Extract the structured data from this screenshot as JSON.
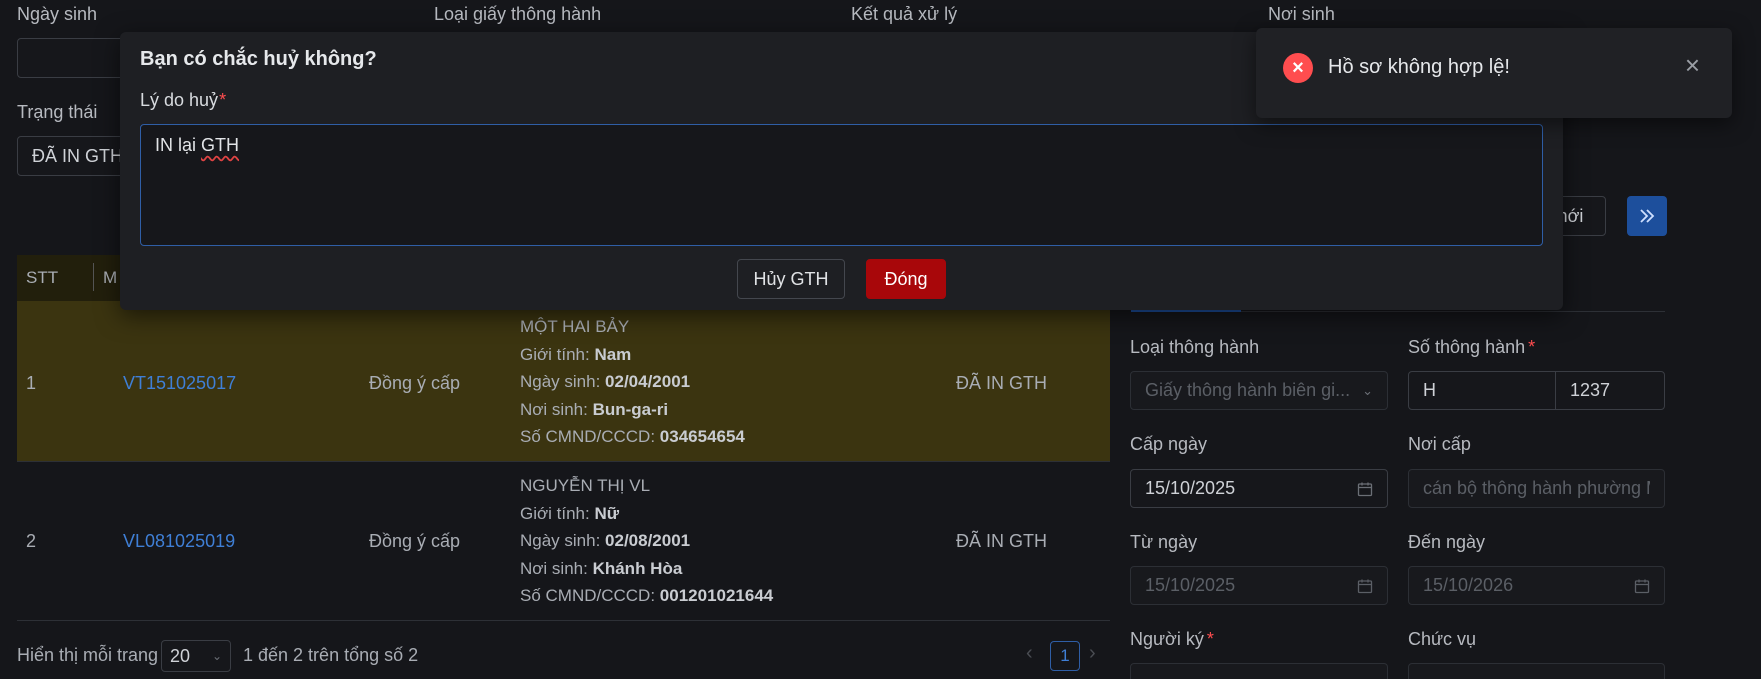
{
  "filters": {
    "ngay_sinh_label": "Ngày sinh",
    "loai_giay_label": "Loại giấy thông hành",
    "ket_qua_label": "Kết quả xử lý",
    "noi_sinh_label": "Nơi sinh",
    "trang_thai_label": "Trạng thái",
    "trang_thai_value": "ĐÃ IN GTH"
  },
  "toolbar": {
    "new_label": "mới",
    "expand_icon": "double-chevron-right-icon"
  },
  "table": {
    "col_stt": "STT",
    "col_ma": "M",
    "rows": [
      {
        "stt": "1",
        "code": "VT151025017",
        "result": "Đồng ý cấp",
        "name": "MỘT HAI BẢY",
        "gender_label": "Giới tính: ",
        "gender": "Nam",
        "dob_label": "Ngày sinh: ",
        "dob": "02/04/2001",
        "pob_label": "Nơi sinh: ",
        "pob": "Bun-ga-ri",
        "id_label": "Số CMND/CCCD: ",
        "id": "034654654",
        "status": "ĐÃ IN GTH"
      },
      {
        "stt": "2",
        "code": "VL081025019",
        "result": "Đồng ý cấp",
        "name": "NGUYỄN THỊ VL",
        "gender_label": "Giới tính: ",
        "gender": "Nữ",
        "dob_label": "Ngày sinh: ",
        "dob": "02/08/2001",
        "pob_label": "Nơi sinh: ",
        "pob": "Khánh Hòa",
        "id_label": "Số CMND/CCCD: ",
        "id": "001201021644",
        "status": "ĐÃ IN GTH"
      }
    ]
  },
  "pagination": {
    "per_page_label": "Hiển thị mỗi trang",
    "per_page_value": "20",
    "summary": "1 đến 2 trên tổng số 2",
    "current_page": "1"
  },
  "form": {
    "loai_thong_hanh_label": "Loại thông hành",
    "loai_thong_hanh_value": "Giấy thông hành biên gi...",
    "so_thong_hanh_label": "Số thông hành",
    "so_prefix": "H",
    "so_number": "1237",
    "cap_ngay_label": "Cấp ngày",
    "cap_ngay_value": "15/10/2025",
    "noi_cap_label": "Nơi cấp",
    "noi_cap_placeholder": "cán bộ thông hành phường M",
    "tu_ngay_label": "Từ ngày",
    "tu_ngay_value": "15/10/2025",
    "den_ngay_label": "Đến ngày",
    "den_ngay_value": "15/10/2026",
    "nguoi_ky_label": "Người ký",
    "chuc_vu_label": "Chức vụ"
  },
  "modal": {
    "title": "Bạn có chắc huỷ không?",
    "reason_label": "Lý do huỷ",
    "reason_prefix": "IN lại ",
    "reason_spell": "GTH",
    "cancel_gth_button": "Hủy GTH",
    "close_button": "Đóng"
  },
  "toast": {
    "message": "Hồ sơ không hợp lệ!"
  },
  "colors": {
    "accent": "#3f7fd6",
    "danger": "#a8070a",
    "error": "#ff4d4f",
    "row_highlight": "#3b3410"
  }
}
